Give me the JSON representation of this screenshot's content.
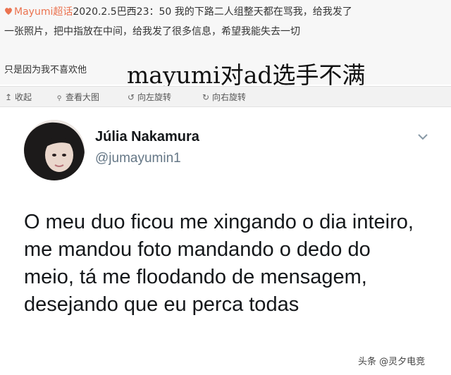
{
  "weibo": {
    "topic_label": "Mayumi超话",
    "post_line1": "2020.2.5巴西23：50 我的下路二人组整天都在骂我，给我发了",
    "post_line2": "一张照片，把中指放在中间，给我发了很多信息，希望我能失去一切",
    "post_line3": "只是因为我不喜欢他",
    "caption": "mayumi对ad选手不满",
    "toolbar": [
      {
        "icon": "↥",
        "label": "收起"
      },
      {
        "icon": "🔍",
        "label": "查看大图"
      },
      {
        "icon": "↺",
        "label": "向左旋转"
      },
      {
        "icon": "↻",
        "label": "向右旋转"
      }
    ]
  },
  "tweet": {
    "name": "Júlia Nakamura",
    "handle": "@jumayumin1",
    "text": "O meu duo ficou me xingando o dia inteiro, me mandou foto mandando o dedo do meio, tá me floodando de mensagem, desejando que eu perca todas"
  },
  "watermark": "头条 @灵夕电竞",
  "colors": {
    "topic": "#eb7350",
    "name": "#14171a",
    "handle": "#657786"
  }
}
